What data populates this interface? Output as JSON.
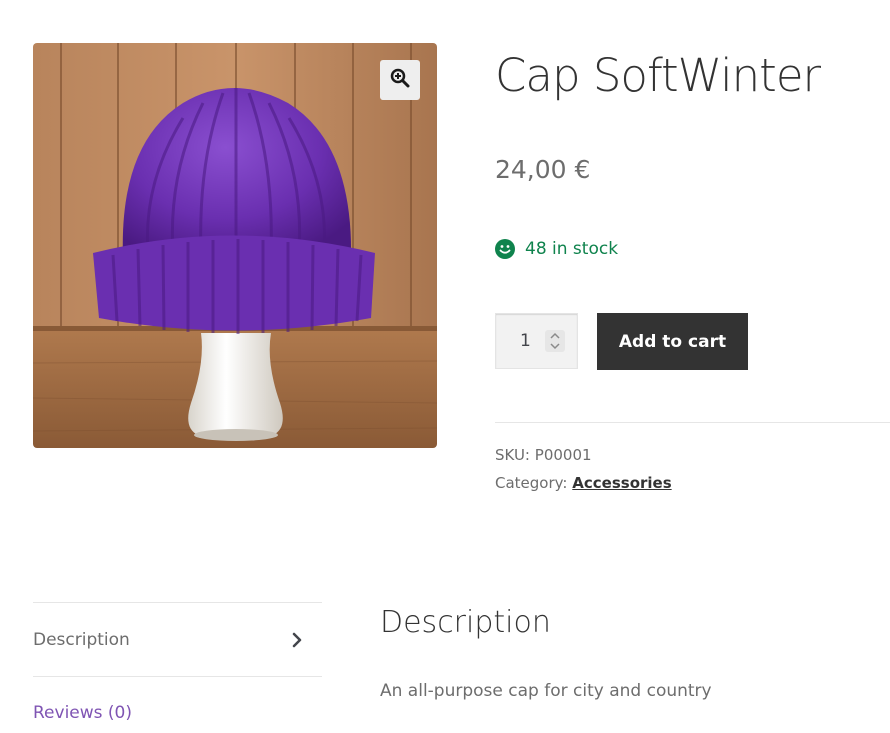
{
  "product": {
    "title": "Cap SoftWinter",
    "price": "24,00 €",
    "stock": "48 in stock",
    "quantity": "1",
    "add_to_cart_label": "Add to cart",
    "sku_label": "SKU:",
    "sku_value": "P00001",
    "category_label": "Category:",
    "category_value": "Accessories"
  },
  "tabs": [
    {
      "label": "Description",
      "active": true
    },
    {
      "label": "Reviews (0)",
      "active": false
    }
  ],
  "panel": {
    "title": "Description",
    "text": "An all-purpose cap for city and country"
  },
  "icons": {
    "zoom": "magnify-plus-icon",
    "stock": "smile-icon",
    "tab_arrow": "chevron-right-icon"
  },
  "colors": {
    "stock_green": "#0f834d",
    "button_dark": "#333333",
    "link_purple": "#7f54b3",
    "cap_purple": "#6a2fb0"
  }
}
